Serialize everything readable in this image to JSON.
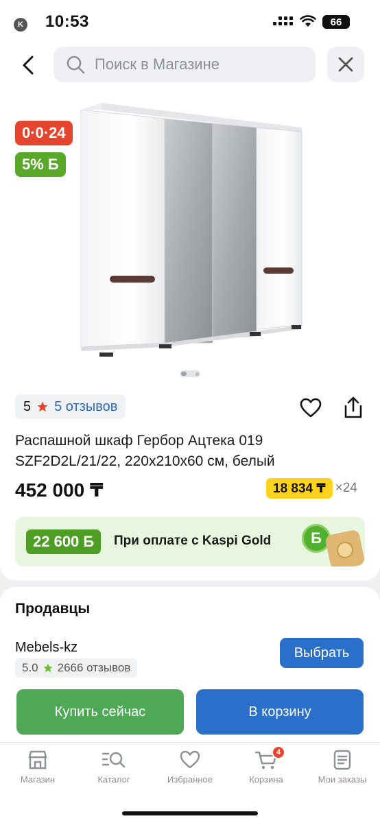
{
  "status_bar": {
    "time": "10:53",
    "app_label": "Kaspi.kz",
    "battery": "66"
  },
  "search": {
    "placeholder": "Поиск в Магазине"
  },
  "product": {
    "timer": "0·0·24",
    "bonus_badge": "5% Б",
    "rating_value": "5",
    "reviews": "5 отзывов",
    "title": "Распашной шкаф Гербор Ацтека 019 SZF2D2L/21/22, 220х210х60 см, белый",
    "price": "452 000 ₸",
    "installment_amount": "18 834 ₸",
    "installment_months": "×24",
    "gallery_images_count": 2,
    "gallery_active_index": 1
  },
  "gold_banner": {
    "bonus": "22 600 Б",
    "text": "При оплате с Kaspi Gold",
    "coin_label": "Б"
  },
  "sellers": {
    "heading": "Продавцы",
    "seller_name": "Mebels-kz",
    "seller_rating": "5.0",
    "seller_reviews": "2666 отзывов",
    "select_label": "Выбрать"
  },
  "actions": {
    "buy_now": "Купить сейчас",
    "to_cart": "В корзину"
  },
  "tabbar": {
    "items": [
      {
        "label": "Магазин",
        "icon": "shop-icon"
      },
      {
        "label": "Каталог",
        "icon": "catalog-search-icon"
      },
      {
        "label": "Избранное",
        "icon": "heart-icon"
      },
      {
        "label": "Корзина",
        "icon": "cart-icon",
        "badge": "4"
      },
      {
        "label": "Мои заказы",
        "icon": "orders-icon"
      }
    ]
  },
  "colors": {
    "accent_blue": "#2a6fc9",
    "green": "#4ea855",
    "red": "#e5452c",
    "yellow": "#ffd21e"
  }
}
